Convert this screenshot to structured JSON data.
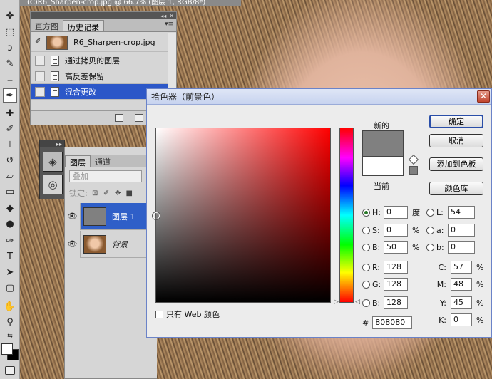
{
  "document": {
    "title_fragment": "(C)R6_Sharpen-crop.jpg @ 66.7% (图层 1, RGB/8*)"
  },
  "history_panel": {
    "tabs": [
      "直方图",
      "历史记录"
    ],
    "active_tab": 1,
    "snapshot": {
      "label": "R6_Sharpen-crop.jpg"
    },
    "items": [
      {
        "label": "通过拷贝的图层"
      },
      {
        "label": "高反差保留"
      },
      {
        "label": "混合更改"
      }
    ],
    "selected_index": 2
  },
  "layers_panel": {
    "tabs": [
      "图层",
      "通道"
    ],
    "active_tab": 0,
    "blend_mode": "叠加",
    "lock_label": "锁定:",
    "layers": [
      {
        "name": "图层 1",
        "selected": true,
        "visible": true
      },
      {
        "name": "背景",
        "selected": false,
        "visible": true
      }
    ]
  },
  "color_picker": {
    "title": "拾色器（前景色）",
    "new_label": "新的",
    "current_label": "当前",
    "buttons": {
      "ok": "确定",
      "cancel": "取消",
      "add_swatch": "添加到色板",
      "libraries": "颜色库"
    },
    "web_only_label": "只有 Web 颜色",
    "hsb": [
      {
        "name": "H:",
        "value": "0",
        "unit": "度",
        "selected": true
      },
      {
        "name": "S:",
        "value": "0",
        "unit": "%",
        "selected": false
      },
      {
        "name": "B:",
        "value": "50",
        "unit": "%",
        "selected": false
      }
    ],
    "rgb": [
      {
        "name": "R:",
        "value": "128"
      },
      {
        "name": "G:",
        "value": "128"
      },
      {
        "name": "B:",
        "value": "128"
      }
    ],
    "lab": [
      {
        "name": "L:",
        "value": "54"
      },
      {
        "name": "a:",
        "value": "0"
      },
      {
        "name": "b:",
        "value": "0"
      }
    ],
    "cmyk": [
      {
        "name": "C:",
        "value": "57",
        "unit": "%"
      },
      {
        "name": "M:",
        "value": "48",
        "unit": "%"
      },
      {
        "name": "Y:",
        "value": "45",
        "unit": "%"
      },
      {
        "name": "K:",
        "value": "0",
        "unit": "%"
      }
    ],
    "hex_label": "#",
    "hex": "808080",
    "new_color": "#808080",
    "current_color": "#ffffff"
  },
  "colors": {
    "selection": "#2c57c8",
    "foreground": "#ffffff",
    "background": "#000000"
  }
}
